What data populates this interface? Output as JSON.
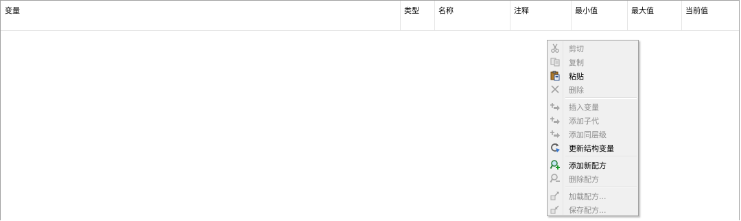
{
  "table": {
    "columns": [
      "变量",
      "类型",
      "名称",
      "注释",
      "最小值",
      "最大值",
      "当前值"
    ]
  },
  "context_menu": {
    "items": [
      {
        "label": "剪切",
        "icon": "scissors-icon",
        "enabled": false
      },
      {
        "label": "复制",
        "icon": "copy-icon",
        "enabled": false
      },
      {
        "label": "粘贴",
        "icon": "clipboard-paste-icon",
        "enabled": true
      },
      {
        "label": "删除",
        "icon": "delete-x-icon",
        "enabled": false
      },
      {
        "label": "插入变量",
        "icon": "insert-arrow-icon",
        "enabled": false
      },
      {
        "label": "添加子代",
        "icon": "add-child-arrow-icon",
        "enabled": false
      },
      {
        "label": "添加同层级",
        "icon": "add-sibling-arrow-icon",
        "enabled": false
      },
      {
        "label": "更新结构变量",
        "icon": "refresh-icon",
        "enabled": true
      },
      {
        "label": "添加新配方",
        "icon": "add-recipe-icon",
        "enabled": true
      },
      {
        "label": "删除配方",
        "icon": "delete-recipe-icon",
        "enabled": false
      },
      {
        "label": "加载配方...",
        "icon": "load-recipe-icon",
        "enabled": false
      },
      {
        "label": "保存配方...",
        "icon": "save-recipe-icon",
        "enabled": false
      }
    ]
  }
}
